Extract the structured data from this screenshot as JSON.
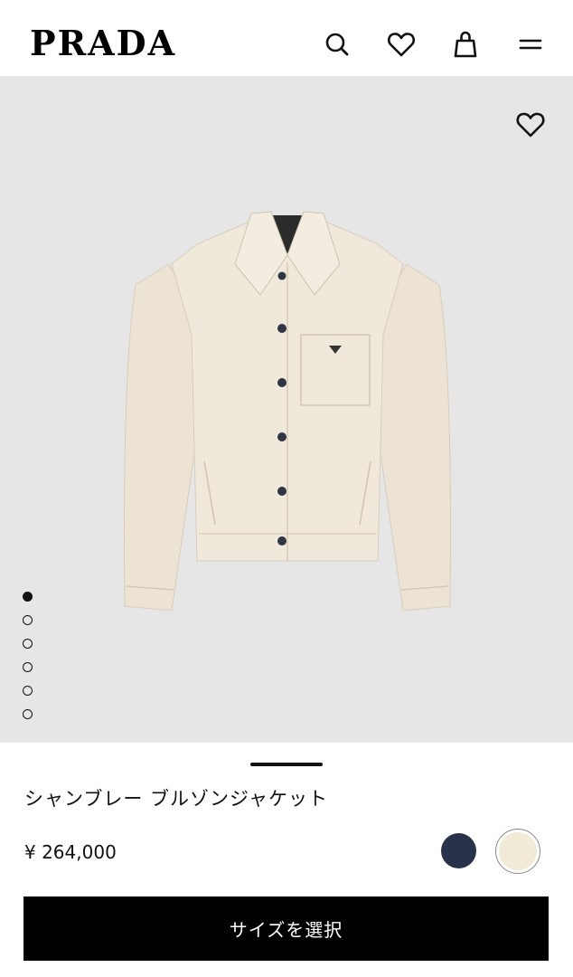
{
  "header": {
    "brand": "PRADA",
    "icons": [
      "search-icon",
      "heart-icon",
      "shopping-bag-icon",
      "menu-icon"
    ]
  },
  "hero": {
    "favorite_icon": "heart-icon",
    "background_color": "#e6e6e7",
    "gallery": {
      "total_images": 6,
      "active_index": 0
    }
  },
  "product": {
    "title": "シャンブレー ブルゾンジャケット",
    "price": "¥ 264,000",
    "colors": [
      "#283249",
      "#f0ead6"
    ],
    "selected_color_index": 1
  },
  "cta": {
    "label": "サイズを選択"
  }
}
